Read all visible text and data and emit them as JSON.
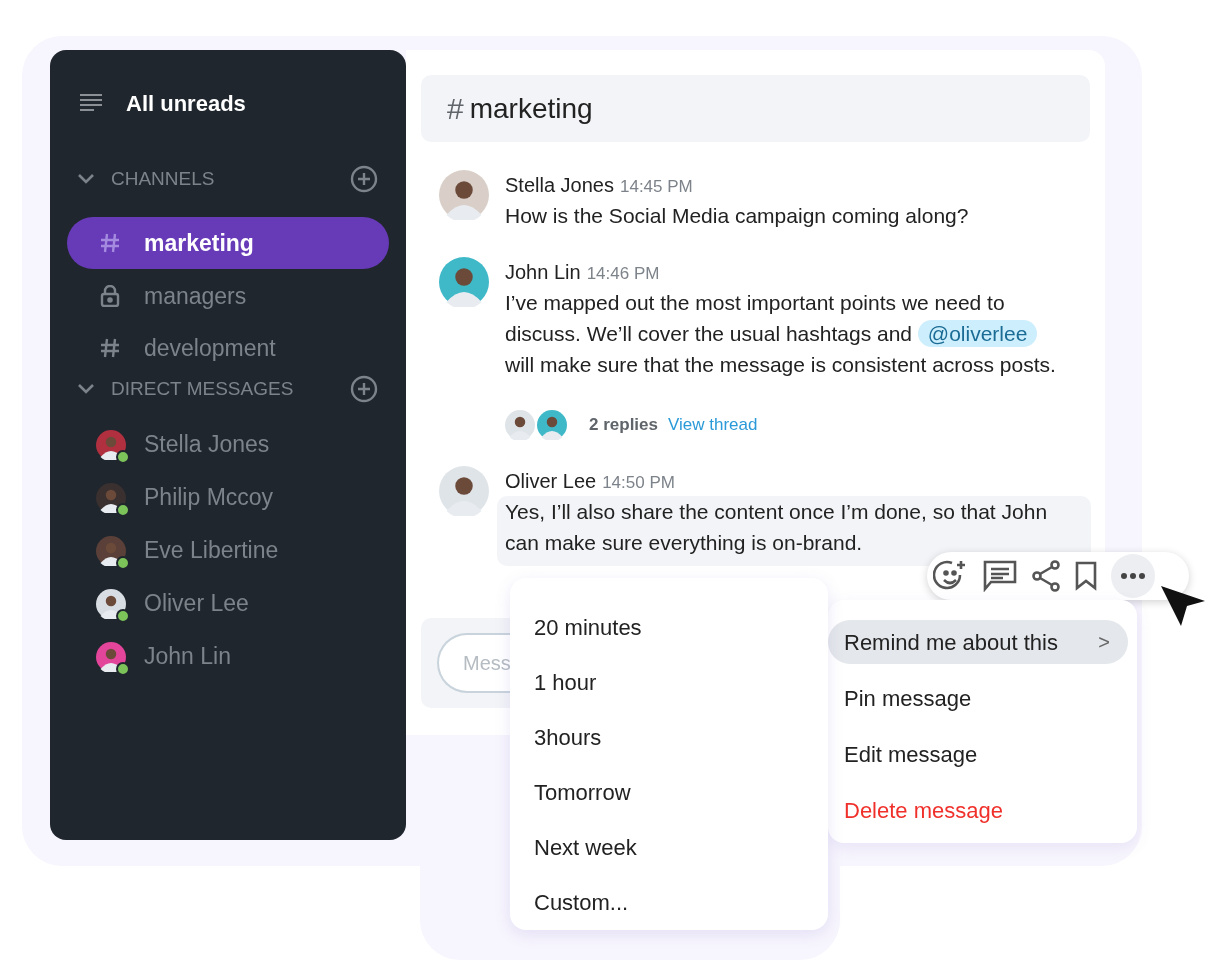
{
  "sidebar": {
    "title": "All unreads",
    "channels_section": {
      "label": "CHANNELS",
      "expanded": true
    },
    "channels": [
      {
        "name": "marketing",
        "kind": "public",
        "selected": true
      },
      {
        "name": "managers",
        "kind": "private",
        "selected": false
      },
      {
        "name": "development",
        "kind": "public",
        "selected": false
      }
    ],
    "dm_section": {
      "label": "DIRECT MESSAGES",
      "expanded": true
    },
    "direct_messages": [
      {
        "name": "Stella Jones",
        "online": true
      },
      {
        "name": "Philip Mccoy",
        "online": true
      },
      {
        "name": "Eve Libertine",
        "online": true
      },
      {
        "name": "Oliver Lee",
        "online": true
      },
      {
        "name": "John Lin",
        "online": true
      }
    ]
  },
  "channel": {
    "prefix": "#",
    "name": "marketing"
  },
  "messages": [
    {
      "author": "Stella Jones",
      "time": "14:45 PM",
      "parts": [
        {
          "kind": "text",
          "text": "How is the Social Media campaign coming along?"
        }
      ],
      "highlighted": false
    },
    {
      "author": "John Lin",
      "time": "14:46 PM",
      "parts": [
        {
          "kind": "text",
          "text": "I’ve mapped out the most important points we need to discuss. We’ll cover the usual hashtags and "
        },
        {
          "kind": "mention",
          "text": "@oliverlee"
        },
        {
          "kind": "text",
          "text": " will make sure that the message is consistent across posts."
        }
      ],
      "thread": {
        "replies": "2 replies",
        "link": "View thread"
      },
      "highlighted": false
    },
    {
      "author": "Oliver Lee",
      "time": "14:50 PM",
      "parts": [
        {
          "kind": "text",
          "text": "Yes, I’ll also share the content once I’m done, so that John can make sure everything is on-brand."
        }
      ],
      "highlighted": true
    }
  ],
  "composer": {
    "placeholder": "Mess"
  },
  "context_menu": [
    {
      "label": "Remind me about this",
      "kind": "submenu",
      "selected": true,
      "submenu_mark": ">"
    },
    {
      "label": "Pin message",
      "kind": "normal",
      "selected": false
    },
    {
      "label": "Edit message",
      "kind": "normal",
      "selected": false
    },
    {
      "label": "Delete message",
      "kind": "danger",
      "selected": false
    }
  ],
  "remind_menu": [
    "20 minutes",
    "1 hour",
    "3hours",
    "Tomorrow",
    "Next week",
    "Custom..."
  ]
}
